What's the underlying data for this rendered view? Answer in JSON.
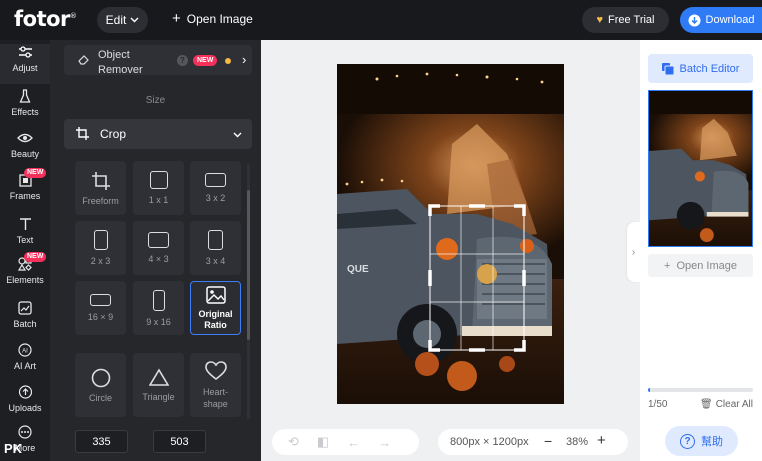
{
  "header": {
    "logo": "fotor",
    "edit_label": "Edit",
    "open_image_label": "Open Image",
    "free_trial_label": "Free Trial",
    "download_label": "Download"
  },
  "rail": {
    "items": [
      {
        "label": "Adjust",
        "icon": "sliders-icon"
      },
      {
        "label": "Effects",
        "icon": "flask-icon"
      },
      {
        "label": "Beauty",
        "icon": "eye-icon"
      },
      {
        "label": "Frames",
        "icon": "frame-icon",
        "badge": "NEW"
      },
      {
        "label": "Text",
        "icon": "text-icon"
      },
      {
        "label": "Elements",
        "icon": "shapes-icon",
        "badge": "NEW"
      },
      {
        "label": "Batch",
        "icon": "batch-icon"
      },
      {
        "label": "AI Art",
        "icon": "ai-icon"
      },
      {
        "label": "Uploads",
        "icon": "cloud-upload-icon"
      },
      {
        "label": "More",
        "icon": "more-icon"
      }
    ]
  },
  "panel": {
    "object_remover_line1": "Object",
    "object_remover_line2": "Remover",
    "object_remover_badge": "NEW",
    "size_label": "Size",
    "crop_label": "Crop",
    "tiles": [
      {
        "label": "Freeform"
      },
      {
        "label": "1 x 1"
      },
      {
        "label": "3 x 2"
      },
      {
        "label": "2 x 3"
      },
      {
        "label": "4 × 3"
      },
      {
        "label": "3 x 4"
      },
      {
        "label": "16 × 9"
      },
      {
        "label": "9 x 16"
      },
      {
        "label": "Original Ratio"
      },
      {
        "label": "Circle"
      },
      {
        "label": "Triangle"
      },
      {
        "label": "Heart-shape"
      }
    ],
    "width_value": "335",
    "height_value": "503",
    "times": "×"
  },
  "canvas": {
    "dimensions": "800px × 1200px",
    "zoom": "38%"
  },
  "right": {
    "batch_editor_label": "Batch Editor",
    "open_image_label": "Open Image",
    "count": "1/50",
    "clear_all_label": "Clear All",
    "help_label": "幫助",
    "progress_fraction": 0.02
  },
  "watermark": "PK",
  "colors": {
    "accent": "#2f7bf6",
    "badge": "#f4305b",
    "topbar": "#18191d",
    "panel": "#26272b"
  }
}
